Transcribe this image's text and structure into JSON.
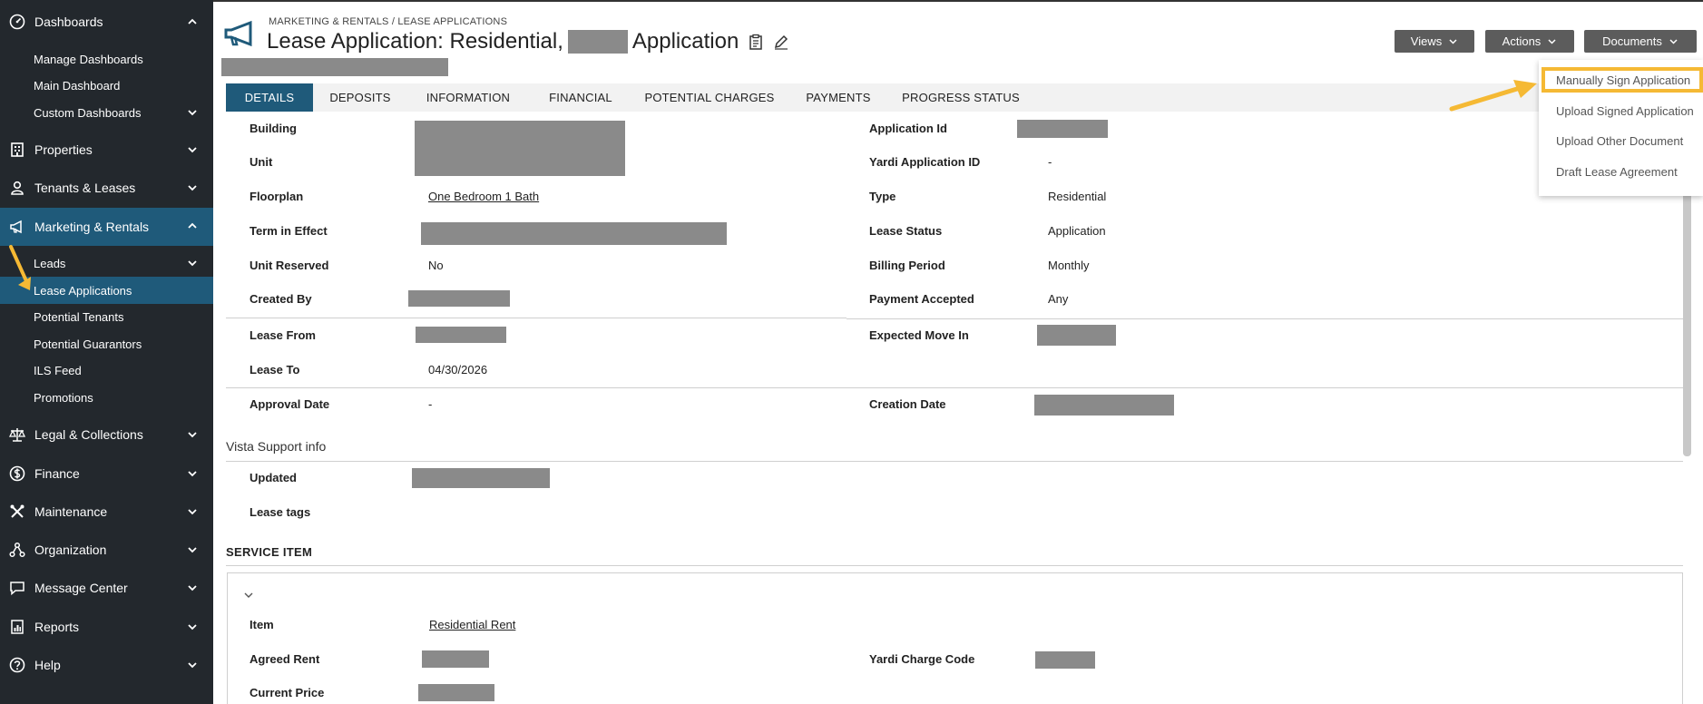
{
  "sidebar": {
    "items": [
      {
        "label": "Dashboards",
        "icon": "dashboard-icon"
      },
      {
        "label": "Manage Dashboards"
      },
      {
        "label": "Main Dashboard"
      },
      {
        "label": "Custom Dashboards"
      },
      {
        "label": "Properties",
        "icon": "building-icon"
      },
      {
        "label": "Tenants & Leases",
        "icon": "person-icon"
      },
      {
        "label": "Marketing & Rentals",
        "icon": "megaphone-icon"
      },
      {
        "label": "Leads"
      },
      {
        "label": "Lease Applications"
      },
      {
        "label": "Potential Tenants"
      },
      {
        "label": "Potential Guarantors"
      },
      {
        "label": "ILS Feed"
      },
      {
        "label": "Promotions"
      },
      {
        "label": "Legal & Collections",
        "icon": "scales-icon"
      },
      {
        "label": "Finance",
        "icon": "finance-icon"
      },
      {
        "label": "Maintenance",
        "icon": "tools-icon"
      },
      {
        "label": "Organization",
        "icon": "organization-icon"
      },
      {
        "label": "Message Center",
        "icon": "message-icon"
      },
      {
        "label": "Reports",
        "icon": "reports-icon"
      },
      {
        "label": "Help",
        "icon": "help-icon"
      }
    ]
  },
  "header": {
    "breadcrumb": "MARKETING & RENTALS / LEASE APPLICATIONS",
    "title_prefix": "Lease Application: Residential,",
    "title_suffix": "Application",
    "buttons": {
      "views": "Views",
      "actions": "Actions",
      "documents": "Documents"
    }
  },
  "documents_menu": {
    "items": [
      "Manually Sign Application",
      "Upload Signed Application",
      "Upload Other Document",
      "Draft Lease Agreement"
    ],
    "highlight_color": "#f5b934"
  },
  "tabs": [
    "DETAILS",
    "DEPOSITS",
    "INFORMATION",
    "FINANCIAL",
    "POTENTIAL CHARGES",
    "PAYMENTS",
    "PROGRESS STATUS"
  ],
  "details": {
    "left": {
      "building": {
        "label": "Building"
      },
      "unit": {
        "label": "Unit"
      },
      "floorplan": {
        "label": "Floorplan",
        "value": "One Bedroom 1 Bath"
      },
      "term": {
        "label": "Term in Effect"
      },
      "unit_reserved": {
        "label": "Unit Reserved",
        "value": "No"
      },
      "created_by": {
        "label": "Created By"
      },
      "lease_from": {
        "label": "Lease From"
      },
      "lease_to": {
        "label": "Lease To",
        "value": "04/30/2026"
      },
      "approval_date": {
        "label": "Approval Date",
        "value": "-"
      }
    },
    "right": {
      "application_id": {
        "label": "Application Id"
      },
      "yardi_app_id": {
        "label": "Yardi Application ID",
        "value": "-"
      },
      "type": {
        "label": "Type",
        "value": "Residential"
      },
      "lease_status": {
        "label": "Lease Status",
        "value": "Application"
      },
      "billing_period": {
        "label": "Billing Period",
        "value": "Monthly"
      },
      "payment_accepted": {
        "label": "Payment Accepted",
        "value": "Any"
      },
      "expected_move_in": {
        "label": "Expected Move In"
      },
      "creation_date": {
        "label": "Creation Date"
      }
    }
  },
  "vista": {
    "title": "Vista Support info",
    "updated": {
      "label": "Updated"
    },
    "lease_tags": {
      "label": "Lease tags"
    }
  },
  "service_item": {
    "title": "SERVICE ITEM",
    "item": {
      "label": "Item",
      "value": "Residential Rent"
    },
    "agreed_rent": {
      "label": "Agreed Rent"
    },
    "current_price": {
      "label": "Current Price"
    },
    "yardi_charge_code": {
      "label": "Yardi Charge Code"
    }
  },
  "colors": {
    "sidebar_bg": "#23282d",
    "accent": "#1f5a7a",
    "button_bg": "#5c5c5c",
    "annotation": "#f5b934"
  }
}
